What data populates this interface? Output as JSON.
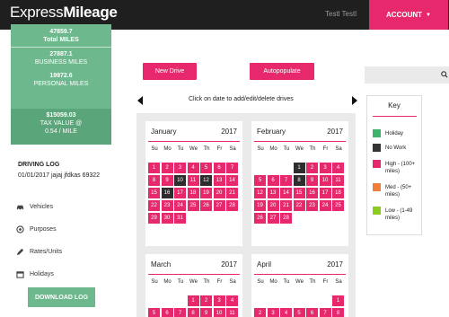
{
  "header": {
    "brand_regular": "Express",
    "brand_bold": "Mileage",
    "user_name": "Testl Testl",
    "account_label": "ACCOUNT"
  },
  "stats": {
    "total_miles_value": "47859.7",
    "total_miles_label": "Total MILES",
    "business_value": "27887.1",
    "business_label": "BUSINESS MILES",
    "personal_value": "19972.6",
    "personal_label": "PERSONAL MILES",
    "tax_value": "$15059.03",
    "tax_label_1": "TAX VALUE @",
    "tax_label_2": "0.54 / MILE"
  },
  "log": {
    "title": "DRIVING LOG",
    "subtitle": "01/01/2017 jajaj jfdkas 69322"
  },
  "nav": [
    {
      "label": "Vehicles",
      "icon": "car-icon"
    },
    {
      "label": "Purposes",
      "icon": "target-icon"
    },
    {
      "label": "Rates/Units",
      "icon": "pencil-icon"
    },
    {
      "label": "Holidays",
      "icon": "calendar-icon"
    }
  ],
  "download_label": "DOWNLOAD LOG",
  "actions": {
    "new_drive": "New Drive",
    "autopopulate": "Autopopulate",
    "instruction": "Click on date to add/edit/delete drives"
  },
  "weekdays": [
    "Su",
    "Mo",
    "Tu",
    "We",
    "Th",
    "Fr",
    "Sa"
  ],
  "calendars": [
    {
      "month": "January",
      "year": "2017",
      "start": 0,
      "days": 31,
      "dark": [
        10,
        12,
        16
      ]
    },
    {
      "month": "February",
      "year": "2017",
      "start": 3,
      "days": 28,
      "dark": [
        1,
        8
      ]
    },
    {
      "month": "March",
      "year": "2017",
      "start": 3,
      "days": 11,
      "dark": []
    },
    {
      "month": "April",
      "year": "2017",
      "start": 6,
      "days": 8,
      "dark": []
    }
  ],
  "key": {
    "title": "Key",
    "items": [
      {
        "label": "Holiday",
        "color": "#3db36b"
      },
      {
        "label": "No Work",
        "color": "#333333"
      },
      {
        "label": "High - (100+ miles)",
        "color": "#e8286d"
      },
      {
        "label": "Med - (50+ miles)",
        "color": "#f07d3a"
      },
      {
        "label": "Low - (1-49 miles)",
        "color": "#8ccc1e"
      }
    ]
  },
  "colors": {
    "accent": "#e8286d",
    "green": "#6db88d",
    "dark": "#1f1f1f"
  }
}
